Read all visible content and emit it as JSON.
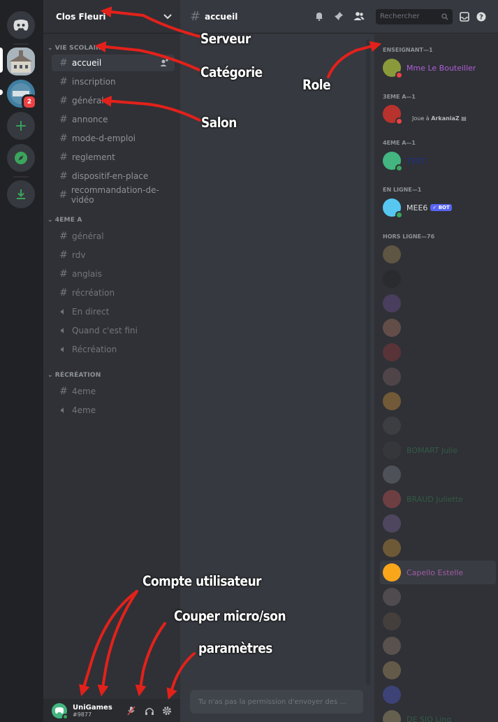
{
  "server": {
    "name": "Clos Fleuri"
  },
  "categories": [
    {
      "name": "VIE SCOLAIRE",
      "channels": [
        {
          "name": "accueil",
          "type": "text",
          "active": true
        },
        {
          "name": "inscription",
          "type": "text"
        },
        {
          "name": "général",
          "type": "text"
        },
        {
          "name": "annonce",
          "type": "text"
        },
        {
          "name": "mode-d-emploi",
          "type": "text"
        },
        {
          "name": "reglement",
          "type": "text"
        },
        {
          "name": "dispositif-en-place",
          "type": "text"
        },
        {
          "name": "recommandation-de-vidéo",
          "type": "text"
        }
      ]
    },
    {
      "name": "4EME A",
      "channels": [
        {
          "name": "général",
          "type": "text-locked"
        },
        {
          "name": "rdv",
          "type": "text-locked"
        },
        {
          "name": "anglais",
          "type": "text-locked"
        },
        {
          "name": "récréation",
          "type": "text-locked"
        },
        {
          "name": "En direct",
          "type": "voice-locked"
        },
        {
          "name": "Quand c'est fini",
          "type": "voice-locked"
        },
        {
          "name": "Récréation",
          "type": "voice-locked"
        }
      ]
    },
    {
      "name": "RÉCRÉATION",
      "channels": [
        {
          "name": "4eme",
          "type": "text-locked"
        },
        {
          "name": "4eme",
          "type": "voice-locked"
        }
      ]
    }
  ],
  "rail": {
    "badge_count": "2"
  },
  "chat": {
    "channel_name": "accueil",
    "search_placeholder": "Rechercher",
    "input_placeholder": "Tu n'as pas la permission d'envoyer des ..."
  },
  "user": {
    "name": "UniGames",
    "tag": "#9877"
  },
  "members": {
    "groups": [
      {
        "header": "ENSEIGNANT—1",
        "members": [
          {
            "name": "Mme Le Bouteiller",
            "color": "#b15fd9",
            "status": "dnd"
          }
        ]
      },
      {
        "header": "3EME A—1",
        "members": [
          {
            "name": "",
            "color": "#3ba55c",
            "status": "dnd",
            "activity_prefix": "Joue à ",
            "activity": "ArkaniaZ"
          }
        ]
      },
      {
        "header": "4EME A—1",
        "members": [
          {
            "name": "TEST",
            "color": "#1f2f8f",
            "status": "online"
          }
        ]
      },
      {
        "header": "EN LIGNE—1",
        "members": [
          {
            "name": "MEE6",
            "color": "#dcddde",
            "status": "online",
            "bot_tag": "✓ BOT"
          }
        ]
      },
      {
        "header": "HORS LIGNE—76",
        "members": [
          {
            "name": "",
            "color": "#a05aa6"
          },
          {
            "name": "",
            "color": "#a05aa6"
          },
          {
            "name": "",
            "color": "#a05aa6"
          },
          {
            "name": "",
            "color": "#3ba55c"
          },
          {
            "name": "",
            "color": "#e35959"
          },
          {
            "name": "",
            "color": "#a05aa6"
          },
          {
            "name": "",
            "color": "#a05aa6"
          },
          {
            "name": "",
            "color": "#3ba55c"
          },
          {
            "name": "BOMART Julie",
            "color": "#3ba55c"
          },
          {
            "name": "",
            "color": "#a05aa6"
          },
          {
            "name": "BRAUD Juliette",
            "color": "#3ba55c"
          },
          {
            "name": "",
            "color": "#a05aa6"
          },
          {
            "name": "",
            "color": "#a05aa6"
          },
          {
            "name": "Capello Estelle",
            "color": "#a05aa6",
            "highlight": true
          },
          {
            "name": "",
            "color": "#a05aa6"
          },
          {
            "name": "",
            "color": "#a05aa6"
          },
          {
            "name": "",
            "color": "#a05aa6"
          },
          {
            "name": "",
            "color": "#a05aa6"
          },
          {
            "name": "",
            "color": "#a05aa6"
          },
          {
            "name": "DE SIO Lino",
            "color": "#3ba55c"
          }
        ]
      }
    ]
  },
  "annotations": {
    "serveur": "Serveur",
    "categorie": "Catégorie",
    "role": "Role",
    "salon": "Salon",
    "compte": "Compte utilisateur",
    "couper": "Couper micro/son",
    "parametres": "paramètres"
  }
}
